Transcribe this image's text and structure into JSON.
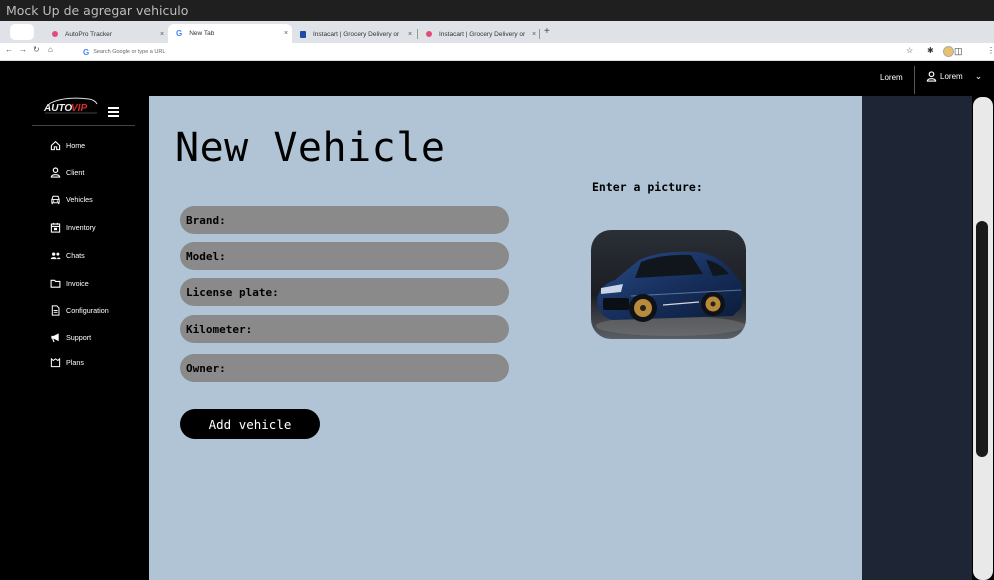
{
  "window": {
    "title": "Mock Up de agregar vehiculo"
  },
  "browser": {
    "tabs": [
      {
        "label": "AutoPro Tracker",
        "favicon": "pink-dot-icon",
        "color": "#e64a7b"
      },
      {
        "label": "New Tab",
        "favicon": "google-icon",
        "active": true
      },
      {
        "label": "Instacart | Grocery Delivery or",
        "favicon": "paypal-icon",
        "color": "#1f4aa8"
      },
      {
        "label": "Instacart | Grocery Delivery or",
        "favicon": "pink-dot-icon",
        "color": "#e64a7b"
      }
    ],
    "new_tab_label": "+",
    "omnibox_placeholder": "Search Google or type a URL"
  },
  "header": {
    "left_label": "Lorem",
    "user_label": "Lorem"
  },
  "sidebar": {
    "items": [
      {
        "label": "Home",
        "icon": "home-icon"
      },
      {
        "label": "Client",
        "icon": "user-icon"
      },
      {
        "label": "Vehicles",
        "icon": "car-icon"
      },
      {
        "label": "Inventory",
        "icon": "inventory-icon"
      },
      {
        "label": "Chats",
        "icon": "chats-icon"
      },
      {
        "label": "Invoice",
        "icon": "folder-icon"
      },
      {
        "label": "Configuration",
        "icon": "document-icon"
      },
      {
        "label": "Support",
        "icon": "megaphone-icon"
      },
      {
        "label": "Plans",
        "icon": "plans-icon"
      }
    ]
  },
  "form": {
    "title": "New Vehicle",
    "fields": [
      {
        "label": "Brand:"
      },
      {
        "label": "Model:"
      },
      {
        "label": "License plate:"
      },
      {
        "label": "Kilometer:"
      },
      {
        "label": "Owner:"
      }
    ],
    "submit_label": "Add vehicle",
    "picture_label": "Enter a picture:"
  },
  "colors": {
    "main_bg": "#b0c4d6",
    "field_bg": "#8a8a8a",
    "sidebar_bg": "#000000",
    "right_panel_bg": "#1e2636"
  }
}
